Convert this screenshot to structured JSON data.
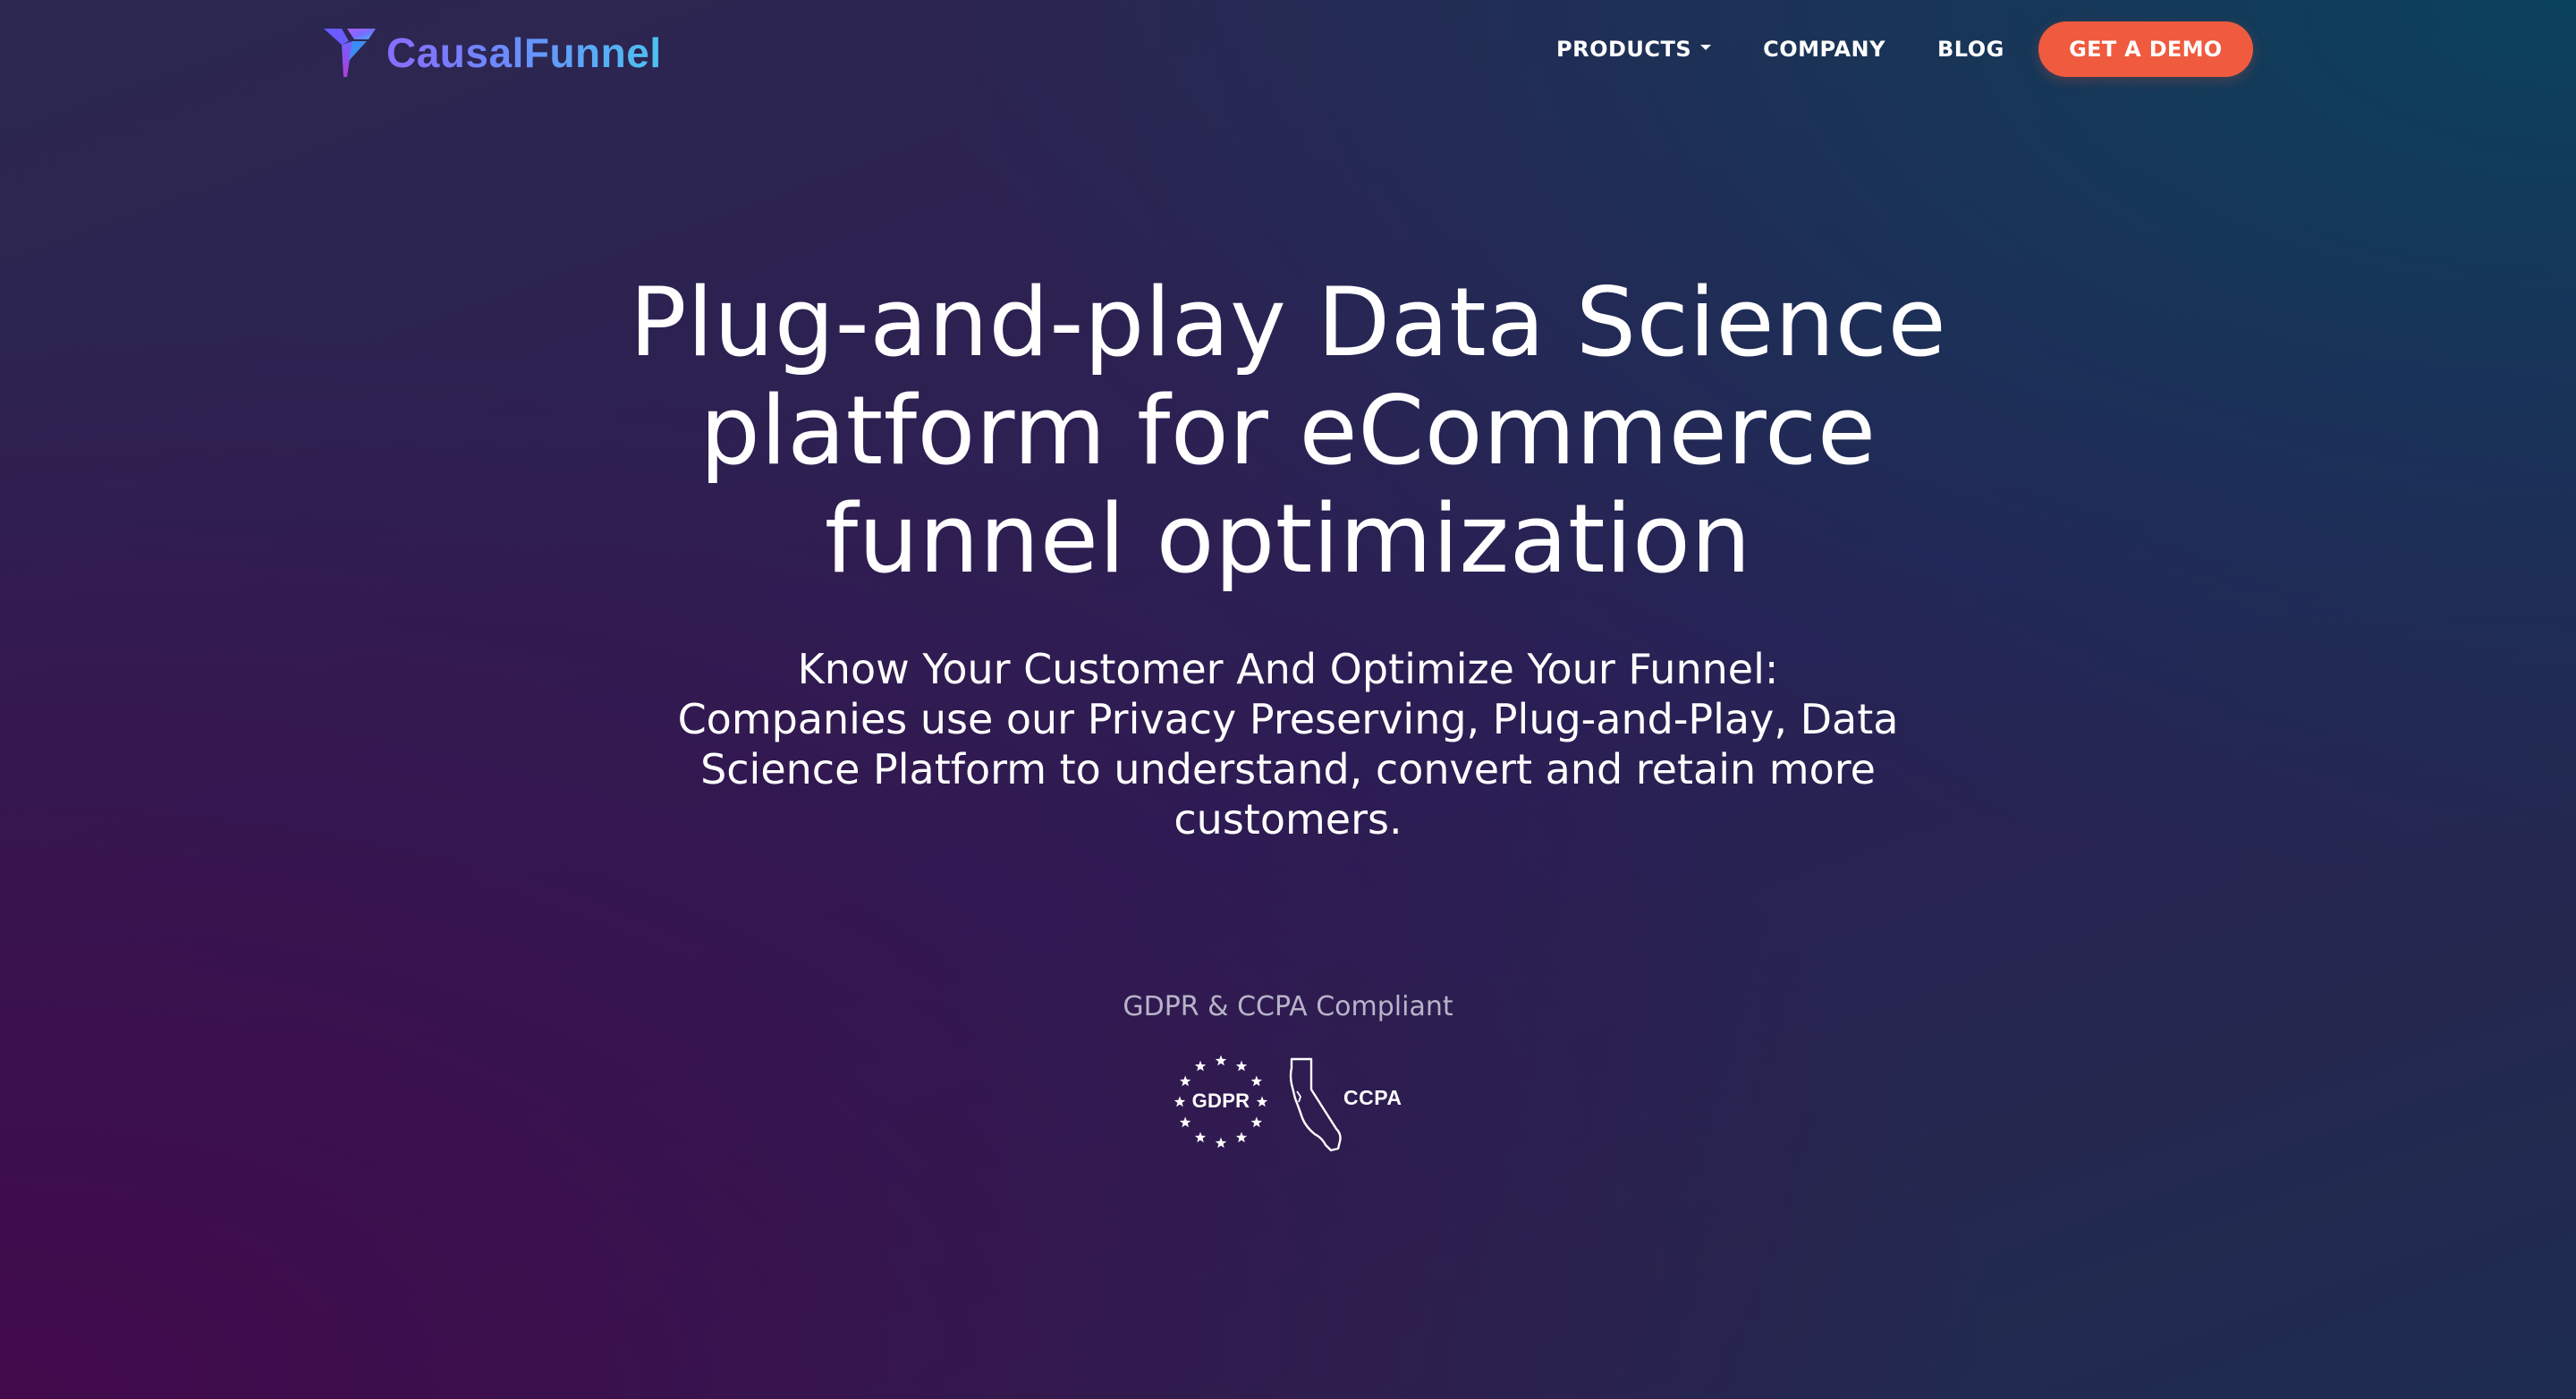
{
  "brand": {
    "name": "CausalFunnel"
  },
  "nav": {
    "items": [
      {
        "label": "PRODUCTS",
        "has_dropdown": true
      },
      {
        "label": "COMPANY",
        "has_dropdown": false
      },
      {
        "label": "BLOG",
        "has_dropdown": false
      }
    ],
    "cta_label": "GET A DEMO"
  },
  "hero": {
    "title": "Plug-and-play Data Science\nplatform for eCommerce\nfunnel optimization",
    "subtitle": "Know Your Customer And Optimize Your Funnel:\nCompanies use our Privacy Preserving, Plug-and-Play, Data\nScience Platform to understand, convert and retain more\ncustomers."
  },
  "compliance": {
    "label": "GDPR & CCPA Compliant",
    "badges": [
      {
        "text": "GDPR",
        "icon": "eu-stars-icon"
      },
      {
        "text": "CCPA",
        "icon": "california-outline-icon"
      }
    ]
  },
  "colors": {
    "cta_background": "#f05a3e",
    "logo_gradient_start": "#8a6cff",
    "logo_gradient_end": "#4cc3f0",
    "background_top_left": "#2b2850",
    "background_bottom_left": "#42094b",
    "background_top_right": "#09445c"
  }
}
